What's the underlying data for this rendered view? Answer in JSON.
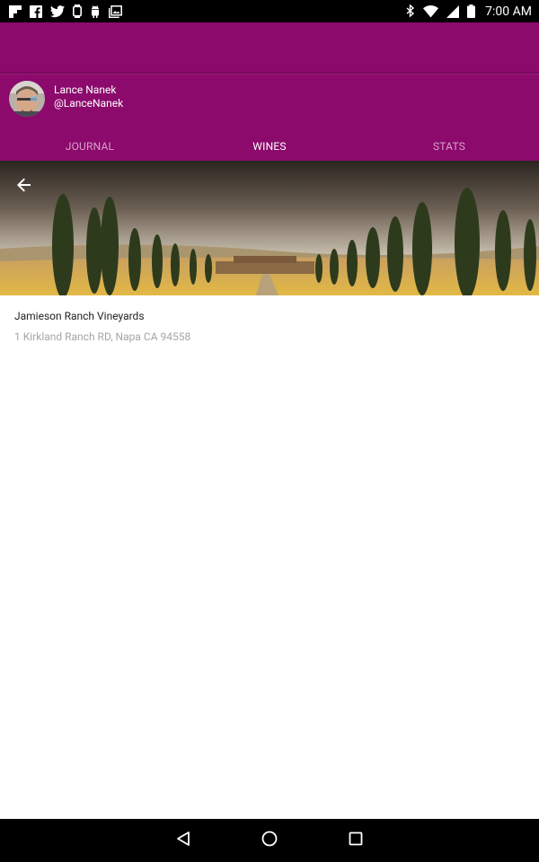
{
  "status_bar": {
    "time": "7:00 AM",
    "left_icons": [
      "flipboard-icon",
      "facebook-icon",
      "twitter-icon",
      "watch-icon",
      "android-icon",
      "photo-icon"
    ],
    "right_icons": [
      "bluetooth-icon",
      "wifi-icon",
      "signal-icon",
      "battery-icon"
    ]
  },
  "colors": {
    "primary": "#8b0a6c",
    "tab_active": "#ffffff",
    "tab_inactive": "#d7a0c8"
  },
  "profile": {
    "name": "Lance Nanek",
    "handle": "@LanceNanek"
  },
  "tabs": [
    {
      "label": "JOURNAL",
      "active": false
    },
    {
      "label": "WINES",
      "active": true
    },
    {
      "label": "STATS",
      "active": false
    }
  ],
  "place": {
    "name": "Jamieson Ranch Vineyards",
    "address": "1 Kirkland Ranch RD, Napa CA 94558"
  },
  "nav": [
    "back-nav-icon",
    "home-nav-icon",
    "recents-nav-icon"
  ]
}
